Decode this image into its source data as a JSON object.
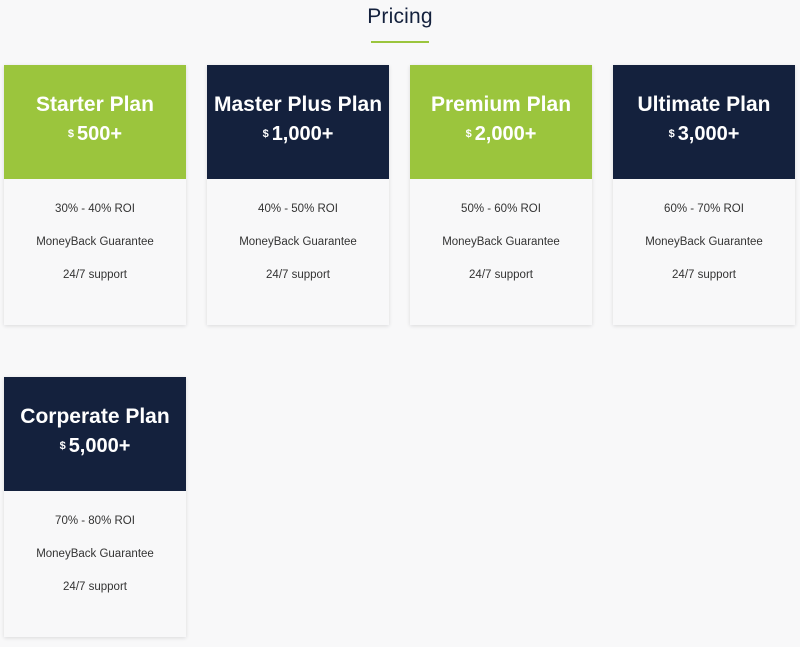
{
  "section": {
    "title": "Pricing",
    "accent_color": "#9bc53d",
    "dark_color": "#14213d"
  },
  "plans": [
    {
      "name": "Starter Plan",
      "currency": "$",
      "price": "500+",
      "header_color": "green",
      "features": [
        "30% - 40% ROI",
        "MoneyBack Guarantee",
        "24/7 support"
      ]
    },
    {
      "name": "Master Plus Plan",
      "currency": "$",
      "price": "1,000+",
      "header_color": "navy",
      "features": [
        "40% - 50% ROI",
        "MoneyBack Guarantee",
        "24/7 support"
      ]
    },
    {
      "name": "Premium Plan",
      "currency": "$",
      "price": "2,000+",
      "header_color": "green",
      "features": [
        "50% - 60% ROI",
        "MoneyBack Guarantee",
        "24/7 support"
      ]
    },
    {
      "name": "Ultimate Plan",
      "currency": "$",
      "price": "3,000+",
      "header_color": "navy",
      "features": [
        "60% - 70% ROI",
        "MoneyBack Guarantee",
        "24/7 support"
      ]
    },
    {
      "name": "Corperate Plan",
      "currency": "$",
      "price": "5,000+",
      "header_color": "navy",
      "features": [
        "70% - 80% ROI",
        "MoneyBack Guarantee",
        "24/7 support"
      ]
    }
  ]
}
